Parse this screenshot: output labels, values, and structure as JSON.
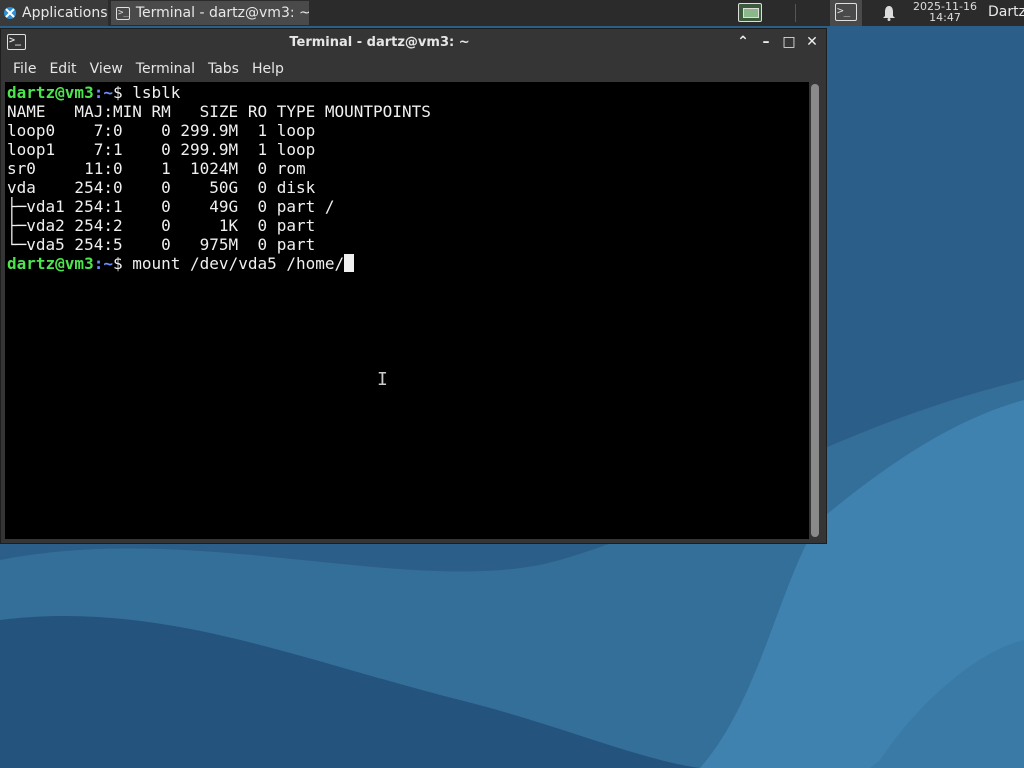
{
  "desktop": {
    "wallpaper_colors": [
      "#2a5d86",
      "#3d7ca8",
      "#22507a"
    ]
  },
  "panel": {
    "applications_label": "Applications",
    "task_title": "Terminal - dartz@vm3: ~",
    "clock_date": "2025-11-16",
    "clock_time": "14:47",
    "user": "Dartz",
    "icons": {
      "app_logo": "xfce-logo-icon",
      "task": "terminal-icon",
      "tray_monitor": "monitor-icon",
      "tray_terminal": "terminal-icon",
      "notifications": "bell-icon"
    }
  },
  "window": {
    "title": "Terminal - dartz@vm3: ~",
    "buttons": {
      "raise": "⌃",
      "minimize": "–",
      "maximize": "□",
      "close": "✕"
    },
    "menu": [
      "File",
      "Edit",
      "View",
      "Terminal",
      "Tabs",
      "Help"
    ]
  },
  "terminal": {
    "prompt_user": "dartz@vm3",
    "prompt_path": ":~",
    "prompt_symbol": "$ ",
    "command1": "lsblk",
    "output": [
      "NAME   MAJ:MIN RM   SIZE RO TYPE MOUNTPOINTS",
      "loop0    7:0    0 299.9M  1 loop",
      "loop1    7:1    0 299.9M  1 loop",
      "sr0     11:0    1  1024M  0 rom",
      "vda    254:0    0    50G  0 disk",
      "├─vda1 254:1    0    49G  0 part /",
      "├─vda2 254:2    0     1K  0 part",
      "└─vda5 254:5    0   975M  0 part"
    ],
    "command2": "mount /dev/vda5 /home/",
    "colors": {
      "user": "#4ee44e",
      "path": "#6b8dff",
      "text": "#f0f0f0",
      "background": "#000000"
    }
  }
}
